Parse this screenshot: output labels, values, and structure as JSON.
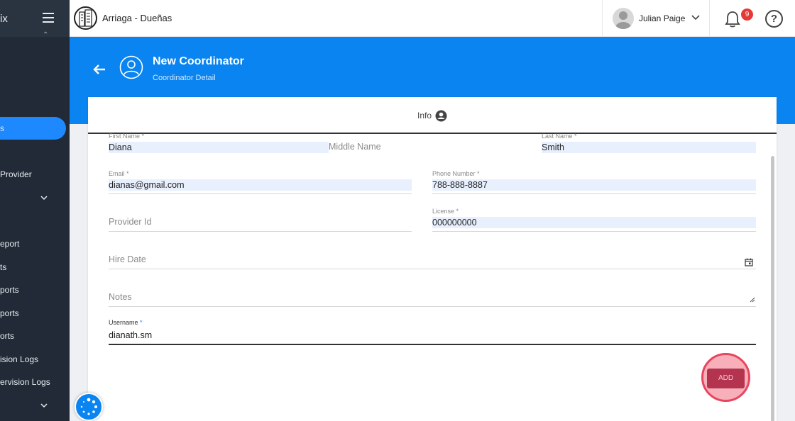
{
  "sidebar": {
    "brand_partial": "ix",
    "items": [
      {
        "label": "s",
        "active": true
      },
      {
        "label": "Provider"
      },
      {
        "label": "eport"
      },
      {
        "label": "ts"
      },
      {
        "label": "ports"
      },
      {
        "label": "ports"
      },
      {
        "label": "orts"
      },
      {
        "label": "ision Logs"
      },
      {
        "label": "ervision Logs"
      }
    ]
  },
  "topbar": {
    "org_name": "Arriaga - Dueñas",
    "user_name": "Julian Paige",
    "notification_count": "9",
    "help_symbol": "?"
  },
  "header": {
    "title": "New Coordinator",
    "subtitle": "Coordinator Detail"
  },
  "tabs": {
    "info_label": "Info"
  },
  "form": {
    "first_name": {
      "label": "First Name *",
      "value": "Diana"
    },
    "middle_name": {
      "placeholder": "Middle Name"
    },
    "last_name": {
      "label": "Last Name *",
      "value": "Smith"
    },
    "email": {
      "label": "Email *",
      "value": "dianas@gmail.com"
    },
    "phone": {
      "label": "Phone Number *",
      "value": "788-888-8887"
    },
    "provider_id": {
      "placeholder": "Provider Id"
    },
    "license": {
      "label": "License *",
      "value": "000000000"
    },
    "hire_date": {
      "placeholder": "Hire Date"
    },
    "notes": {
      "placeholder": "Notes"
    },
    "username": {
      "label": "Username",
      "required_mark": "*",
      "value": "dianath.sm"
    },
    "add_label": "ADD"
  },
  "colors": {
    "accent": "#0a84f0",
    "sidebar": "#212a36",
    "add_button": "#b4334e",
    "badge": "#e53935"
  }
}
